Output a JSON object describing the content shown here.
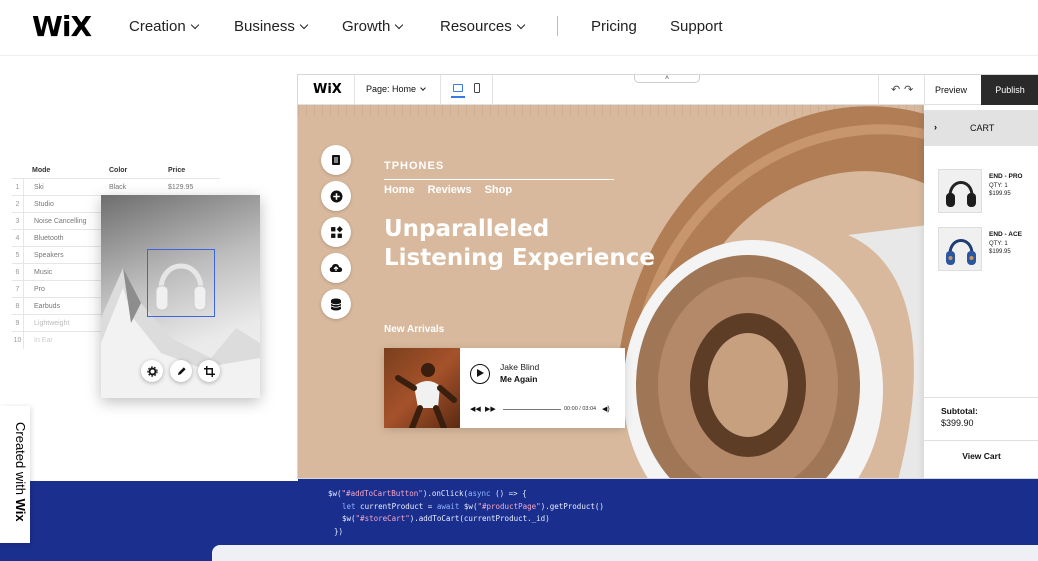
{
  "nav": {
    "logo": "WiX",
    "items": [
      {
        "label": "Creation"
      },
      {
        "label": "Business"
      },
      {
        "label": "Growth"
      },
      {
        "label": "Resources"
      }
    ],
    "pricing": "Pricing",
    "support": "Support"
  },
  "table": {
    "headers": {
      "mode": "Mode",
      "color": "Color",
      "price": "Price"
    },
    "rows": [
      {
        "n": "1",
        "mode": "Ski",
        "color": "Black",
        "price": "$129.95"
      },
      {
        "n": "2",
        "mode": "Studio"
      },
      {
        "n": "3",
        "mode": "Noise Cancelling"
      },
      {
        "n": "4",
        "mode": "Bluetooth"
      },
      {
        "n": "5",
        "mode": "Speakers"
      },
      {
        "n": "6",
        "mode": "Music"
      },
      {
        "n": "7",
        "mode": "Pro"
      },
      {
        "n": "8",
        "mode": "Earbuds"
      },
      {
        "n": "9",
        "mode": "Lightweight"
      },
      {
        "n": "10",
        "mode": "In Ear"
      }
    ]
  },
  "created_with": {
    "prefix": "Created with ",
    "brand": "Wix"
  },
  "editor": {
    "logo": "WiX",
    "page_selector": "Page: Home",
    "tab_handle": "˄",
    "undo": "↶",
    "redo": "↷",
    "preview": "Preview",
    "publish": "Publish"
  },
  "site": {
    "brand": "TPHONES",
    "subnav": [
      "Home",
      "Reviews",
      "Shop"
    ],
    "headline_line1": "Unparalleled",
    "headline_line2": "Listening Experience",
    "new_arrivals": "New Arrivals",
    "player": {
      "artist": "Jake Blind",
      "song": "Me Again",
      "time": "00:00 / 03:04"
    }
  },
  "cart": {
    "title": "CART",
    "items": [
      {
        "name": "END - PRO",
        "qty": "QTY: 1",
        "price": "$199.95"
      },
      {
        "name": "END - ACE",
        "qty": "QTY: 1",
        "price": "$199.95"
      }
    ],
    "subtotal_label": "Subtotal:",
    "subtotal_value": "$399.90",
    "view_cart": "View Cart"
  },
  "code": {
    "line1_a": "$w(",
    "line1_s": "\"#addToCartButton\"",
    "line1_b": ").onClick(",
    "line1_k": "async",
    "line1_c": " () => {",
    "line2_k1": "let",
    "line2_a": " currentProduct = ",
    "line2_k2": "await",
    "line2_b": " $w(",
    "line2_s": "\"#productPage\"",
    "line2_c": ").getProduct()",
    "line3_a": "$w(",
    "line3_s": "\"#storeCart\"",
    "line3_b": ").addToCart(currentProduct._id)",
    "line4": "})"
  },
  "colors": {
    "accent_blue": "#3b78e7",
    "band_blue": "#1b2f8e",
    "canvas_tan": "#d8b99d",
    "publish_bg": "#2a2a2a"
  }
}
